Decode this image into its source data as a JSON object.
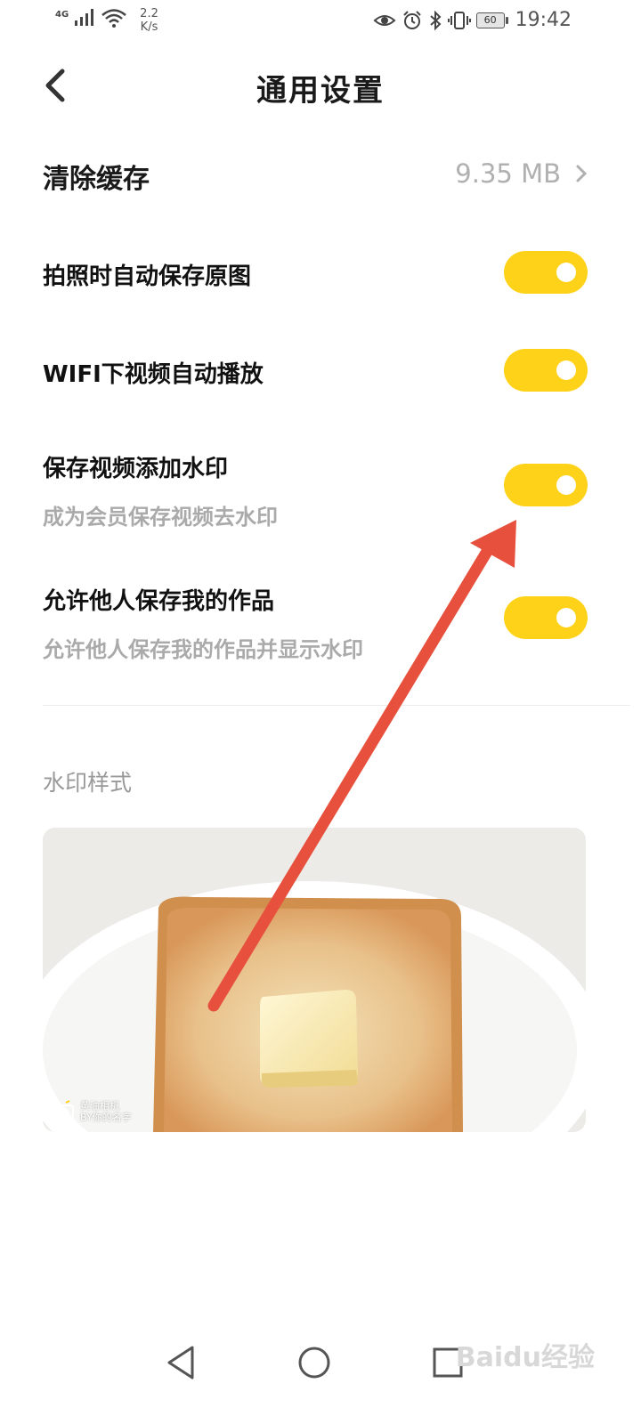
{
  "status_bar": {
    "network": "4G",
    "speed_value": "2.2",
    "speed_unit": "K/s",
    "battery": "60",
    "time": "19:42"
  },
  "header": {
    "title": "通用设置",
    "back_icon": "chevron-left-icon"
  },
  "settings": {
    "clear_cache": {
      "label": "清除缓存",
      "value": "9.35 MB"
    },
    "items": [
      {
        "title": "拍照时自动保存原图",
        "enabled": true
      },
      {
        "title": "WIFI下视频自动播放",
        "enabled": true
      },
      {
        "title": "保存视频添加水印",
        "subtitle": "成为会员保存视频去水印",
        "enabled": true
      },
      {
        "title": "允许他人保存我的作品",
        "subtitle": "允许他人保存我的作品并显示水印",
        "enabled": true
      }
    ]
  },
  "watermark_section": {
    "label": "水印样式",
    "watermark_brand": "黄油相机",
    "watermark_by": "BY你的名字"
  },
  "nav_bar": {
    "buttons": [
      "back-triangle-icon",
      "home-circle-icon",
      "recents-square-icon"
    ]
  },
  "corner_mark": "Baidu经验",
  "colors": {
    "toggle_on": "#ffd21a",
    "annotation_arrow": "#e8503e"
  }
}
